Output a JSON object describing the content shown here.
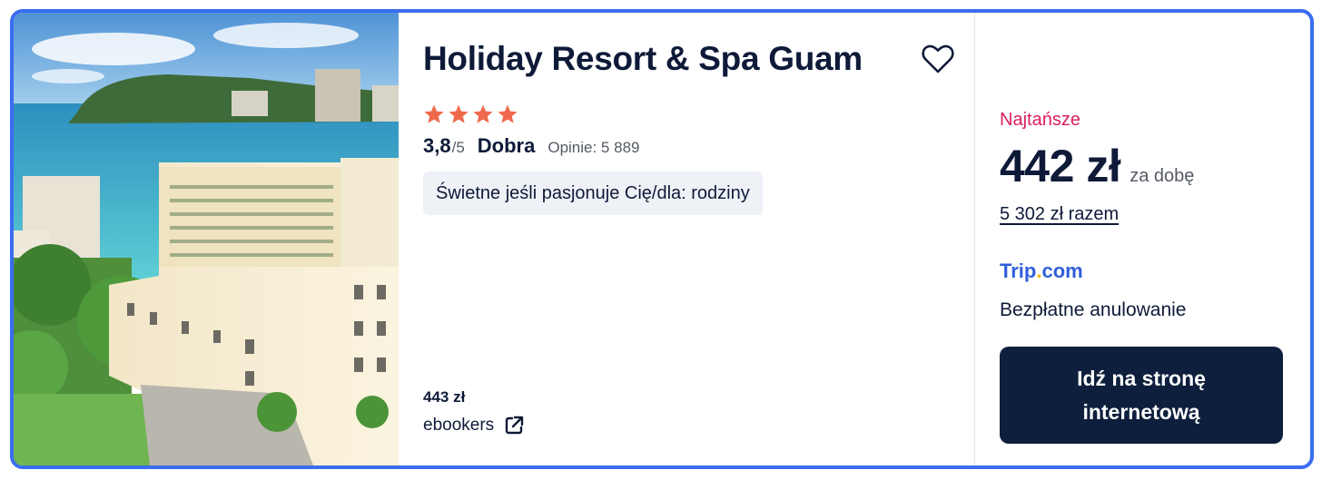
{
  "hotel": {
    "name": "Holiday Resort & Spa Guam",
    "stars": 4,
    "score": "3,8",
    "score_max": "/5",
    "rating_word": "Dobra",
    "reviews": "Opinie: 5 889",
    "chip": "Świetne jeśli pasjonuje Cię/dla: rodziny",
    "image_alt_icon": "hotel-photo"
  },
  "alternative": {
    "price": "443 zł",
    "site": "ebookers",
    "icon": "external-link-icon"
  },
  "offer": {
    "label": "Najtańsze",
    "price": "442 zł",
    "per": "za dobę",
    "total": "5 302 zł razem",
    "provider_part1": "Trip",
    "provider_dot": ".",
    "provider_part2": "com",
    "cancellation": "Bezpłatne anulowanie",
    "cta": "Idź na stronę internetową"
  },
  "colors": {
    "border": "#3a6df0",
    "star": "#ef6a4c",
    "accent_label": "#d91f5a",
    "provider": "#2f5fd8",
    "cta_bg": "#0d1f3c"
  }
}
